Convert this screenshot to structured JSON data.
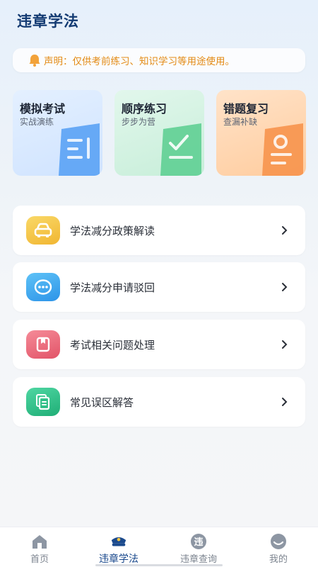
{
  "header": {
    "title": "违章学法"
  },
  "notice": {
    "text": "声明：仅供考前练习、知识学习等用途使用。",
    "icon": "bell-icon",
    "color": "#e38b16"
  },
  "cards": [
    {
      "title": "模拟考试",
      "subtitle": "实战演练",
      "color": "#5aa2f5"
    },
    {
      "title": "顺序练习",
      "subtitle": "步步为营",
      "color": "#5fcf93"
    },
    {
      "title": "错题复习",
      "subtitle": "查漏补缺",
      "color": "#f7944c"
    }
  ],
  "list": [
    {
      "label": "学法减分政策解读",
      "icon": "car-icon",
      "color": "#f5c542"
    },
    {
      "label": "学法减分申请驳回",
      "icon": "chat-bubble-icon",
      "color": "#3da8f0"
    },
    {
      "label": "考试相关问题处理",
      "icon": "bookmark-icon",
      "color": "#ec6b7c"
    },
    {
      "label": "常见误区解答",
      "icon": "documents-icon",
      "color": "#2fbf87"
    }
  ],
  "tabbar": [
    {
      "label": "首页",
      "icon": "home-icon"
    },
    {
      "label": "违章学法",
      "icon": "police-cap-icon",
      "active": true
    },
    {
      "label": "违章查询",
      "icon": "violation-badge-icon",
      "badge_char": "违"
    },
    {
      "label": "我的",
      "icon": "user-icon"
    }
  ]
}
